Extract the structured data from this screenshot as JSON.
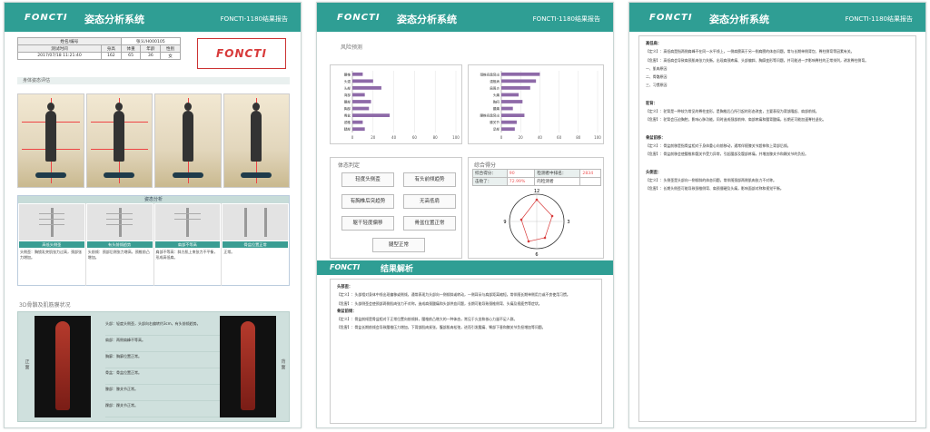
{
  "header": {
    "logo": "FONCTI",
    "title": "姿态分析系统",
    "report": "FONCTI-1180结果报告"
  },
  "info": {
    "headers1": [
      "姓名/编号",
      "",
      "张义/H000105"
    ],
    "headers2": [
      "测试时间",
      "身高",
      "体重",
      "年龄",
      "性别"
    ],
    "values": [
      "2017/07/18 11:21:40",
      "162",
      "65",
      "36",
      "女"
    ]
  },
  "logo_box": "FONCTI",
  "page1": {
    "section1": "身体姿态评估",
    "section2": "体态分析",
    "section3": "3D骨骼及肌筋膜状况",
    "analysis_caption": "姿态分析",
    "columns": [
      {
        "cap": "高低头侧歪",
        "text": "头侧歪：胸锁乳突肌张力过高，颈部张力增加。"
      },
      {
        "cap": "有头前倾趋势",
        "text": "头前倾：颈部后侧张力增高，颈椎前凸增加。"
      },
      {
        "cap": "肩部不等高",
        "text": "肩部不等高：斜方肌上束张力不平衡，形成高低肩。"
      },
      {
        "cap": "骨盆位置正常",
        "text": "正常。"
      }
    ],
    "d3_left": "正面",
    "d3_right": "背面",
    "d3_notes": [
      "头部：轻度头侧歪，头部向右偏转约3cm，有头前倾趋势。",
      "肩部：两侧肩峰不等高。",
      "胸廓：胸廓位置正常。",
      "骨盆：骨盆位置正常。",
      "膝部：膝关节正常。",
      "踝部：踝关节正常。"
    ]
  },
  "page2": {
    "section_risk": "风险预测",
    "section_judge": "体态判定",
    "section_score": "综合得分",
    "banner_title": "结果解析",
    "judgements": [
      "轻度头侧歪",
      "有头前倾趋势",
      "有胸椎后突趋势",
      "无高低肩",
      "躯干轻度偏移",
      "骨盆位置正常",
      "腿型正常"
    ],
    "score_rows": [
      {
        "k1": "综合得分：",
        "v1": "90",
        "k2": "检测者中排名：",
        "v2": "2834"
      },
      {
        "k1": "击败了：",
        "v1": "72.99%",
        "k2": "的检测者",
        "v2": ""
      }
    ],
    "dial_labels": [
      "12",
      "3",
      "6",
      "9"
    ],
    "text_blocks": [
      {
        "head": "头部歪：",
        "paras": [
          "【定义】：头部相对身体中线出现偏移或侧倾，通常表现为头部向一侧倾斜或转动，一侧耳朵与肩部距离缩短，常伴随长期单侧用力或不良使用习惯。",
          "【危害】：头部侧歪会使颈部两侧肌肉张力不对称，造成肩颈酸痛和头部供血问题，长期可能导致颈椎侧弯、头痛及视疲劳等症状。"
        ]
      },
      {
        "head": "骨盆前倾：",
        "paras": [
          "【定义】：骨盆前倾是骨盆相对于正常位置向前倾斜，腰椎前凸增大的一种体态，常见于久坐和核心力量不足人群。",
          "【危害】：骨盆长期前倾会导致腰椎压力增加，下背部肌肉紧张，腹部肌肉松弛，进而引发腰痛、臀部下垂和膝关节负担增加等问题。"
        ]
      }
    ]
  },
  "page3": {
    "blocks": [
      {
        "head": "高低肩：",
        "paras": [
          "【定义】：高低肩是指两侧肩峰不在同一水平线上，一侧肩膀高于另一侧肩膀的体态问题，常与长期单侧背包、脊柱侧弯等因素有关。",
          "【危害】：高低肩会导致肩颈肌肉张力失衡，出现肩颈疼痛、头部偏斜、胸廓变形等问题，并可能进一步影响脊柱的正常排列，诱发脊柱侧弯。",
          "一、肌肉原因",
          "二、骨骼原因",
          "三、习惯原因"
        ]
      },
      {
        "head": "驼背：",
        "paras": [
          "【定义】：驼背是一种较为常见的脊柱变形，是胸椎后凸所引起的形态改变，主要表现为背部隆起、肩部前倾。",
          "【危害】：驼背会压迫胸腔，影响心肺功能，同时造成颈部前伸、肩部疼痛和腰背酸痛，长期还可能加速脊柱退化。"
        ]
      },
      {
        "head": "骨盆前移：",
        "paras": [
          "【定义】：骨盆前移是指骨盆相对于身体重心向前移动，通常伴随膝关节超伸和上背部后倾。",
          "【危害】：骨盆前移会使腰椎和髋关节受力异常，引起腰部及髋部疼痛，并增加膝关节和踝关节的负担。"
        ]
      },
      {
        "head": "头侧歪：",
        "paras": [
          "【定义】：头侧歪是头部向一侧倾斜的体态问题，常伴随颈部两侧肌肉张力不对称。",
          "【危害】：长期头侧歪可能导致颈椎侧弯、肩颈僵硬及头痛，影响面部对称和视觉平衡。"
        ]
      }
    ]
  },
  "chart_data": [
    {
      "type": "bar",
      "orientation": "horizontal",
      "categories": [
        "腰椎",
        "头颈",
        "头部",
        "背部",
        "腰部",
        "胸部",
        "骨盆",
        "颈椎",
        "腿部"
      ],
      "values": [
        10,
        20,
        28,
        12,
        18,
        16,
        36,
        10,
        12
      ],
      "xlim": [
        0,
        100
      ],
      "xticks": [
        "0",
        "20",
        "40",
        "60",
        "80",
        "100"
      ]
    },
    {
      "type": "bar",
      "orientation": "horizontal",
      "categories": [
        "颈椎间盘突出",
        "颈椎病",
        "肩周炎",
        "头痛",
        "胸闷",
        "腰痛",
        "腰椎间盘突出",
        "膝关节",
        "足部"
      ],
      "values": [
        40,
        36,
        30,
        18,
        22,
        12,
        24,
        16,
        14
      ],
      "xlim": [
        0,
        100
      ],
      "xticks": [
        "0",
        "20",
        "40",
        "60",
        "80",
        "100"
      ]
    }
  ],
  "colors": {
    "brand": "#2f9e94",
    "bar": "#8e6aa8",
    "accent": "#d83a3a"
  }
}
